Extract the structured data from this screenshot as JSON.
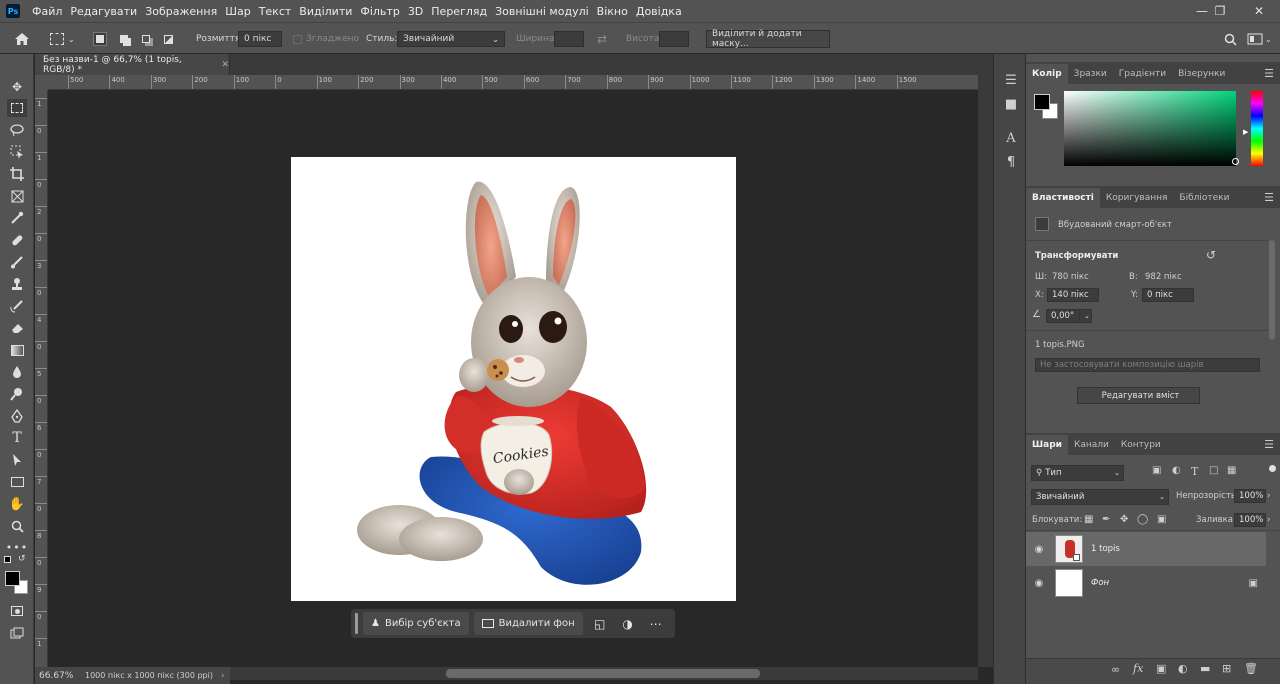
{
  "app": {
    "logo": "Ps"
  },
  "menu": [
    "Файл",
    "Редагувати",
    "Зображення",
    "Шар",
    "Текст",
    "Виділити",
    "Фільтр",
    "3D",
    "Перегляд",
    "Зовнішні модулі",
    "Вікно",
    "Довідка"
  ],
  "options": {
    "feather_label": "Розмиття:",
    "feather_value": "0 пікс",
    "antialias_label": "Згладжено",
    "style_label": "Стиль:",
    "style_value": "Звичайний",
    "width_label": "Ширина:",
    "height_label": "Висота:",
    "mask_button": "Виділити й додати маску..."
  },
  "document": {
    "tab_title": "Без назви-1 @ 66,7% (1 topis, RGB/8) *",
    "artwork_text": "Cookies"
  },
  "ruler_labels": [
    "500",
    "400",
    "300",
    "200",
    "100",
    "0",
    "100",
    "200",
    "300",
    "400",
    "500",
    "600",
    "700",
    "800",
    "900",
    "1000",
    "1100",
    "1200",
    "1300",
    "1400",
    "1500"
  ],
  "ruler_v_labels": [
    "1",
    "0",
    "1",
    "0",
    "2",
    "0",
    "3",
    "0",
    "4",
    "0",
    "5",
    "0",
    "6",
    "0",
    "7",
    "0",
    "8",
    "0",
    "9",
    "0",
    "1"
  ],
  "status": {
    "zoom": "66.67%",
    "size": "1000 пікс x 1000 пікс (300 ppi)"
  },
  "context_bar": {
    "select_subject": "Вибір суб'єкта",
    "remove_bg": "Видалити фон"
  },
  "color_panel": {
    "tabs": [
      "Колір",
      "Зразки",
      "Градієнти",
      "Візерунки"
    ],
    "fg_color": "#000000",
    "bg_color": "#ffffff",
    "hue_color": "#00d47a"
  },
  "properties": {
    "tabs": [
      "Властивості",
      "Коригування",
      "Бібліотеки"
    ],
    "object_type": "Вбудований смарт-об'єкт",
    "transform_title": "Трансформувати",
    "w_label": "Ш:",
    "w_value": "780 пікс",
    "h_label": "В:",
    "h_value": "982 пікс",
    "x_label": "X:",
    "x_value": "140 пікс",
    "y_label": "Y:",
    "y_value": "0 пікс",
    "angle_value": "0,00°",
    "file_name": "1 topis.PNG",
    "comp_placeholder": "Не застосовувати композицію шарів",
    "edit_button": "Редагувати вміст"
  },
  "layers": {
    "tabs": [
      "Шари",
      "Канали",
      "Контури"
    ],
    "filter_label": "Тип",
    "blend_mode": "Звичайний",
    "opacity_label": "Непрозорість:",
    "opacity_value": "100%",
    "lock_label": "Блокувати:",
    "fill_label": "Заливка:",
    "fill_value": "100%",
    "items": [
      {
        "name": "1 topis"
      },
      {
        "name": "Фон"
      }
    ]
  }
}
